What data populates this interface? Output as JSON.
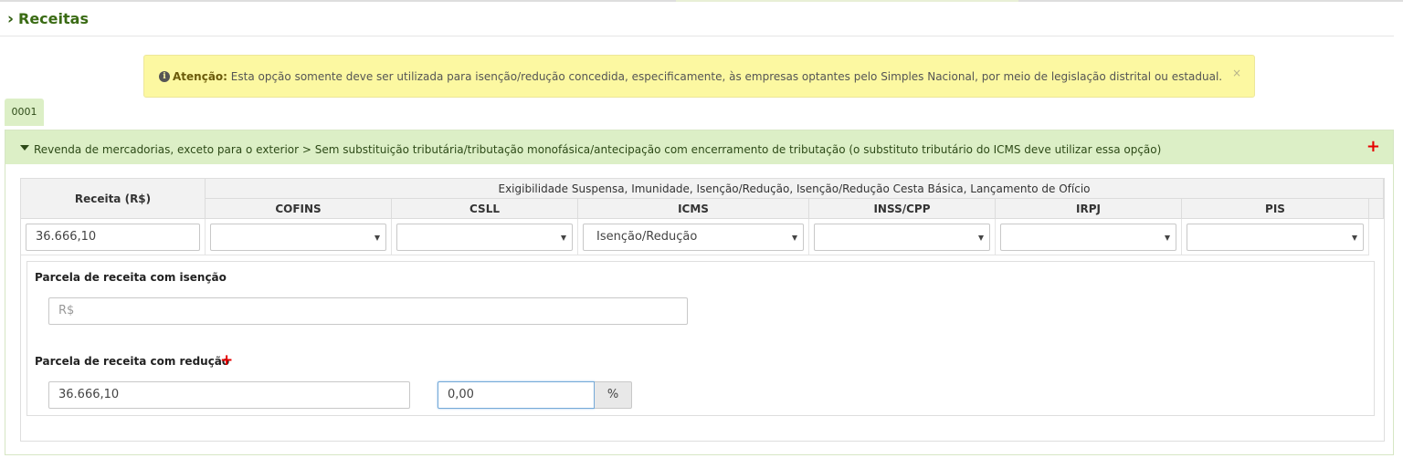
{
  "section": {
    "chevron": "›",
    "title": "Receitas"
  },
  "alert": {
    "icon": "info-circle-icon",
    "icon_glyph": "i",
    "label": "Atenção:",
    "message": "Esta opção somente deve ser utilizada para isenção/redução concedida, especificamente, às empresas optantes pelo Simples Nacional, por meio de legislação distrital ou estadual.",
    "close": "×"
  },
  "establishment": {
    "code": "0001"
  },
  "activity": {
    "title": "Revenda de mercadorias, exceto para o exterior > Sem substituição tributária/tributação monofásica/antecipação com encerramento de tributação (o substituto tributário do ICMS deve utilizar essa opção)",
    "add": "+"
  },
  "table": {
    "receita_header": "Receita (R$)",
    "group_header": "Exigibilidade Suspensa, Imunidade, Isenção/Redução, Isenção/Redução Cesta Básica, Lançamento de Ofício",
    "columns": [
      "COFINS",
      "CSLL",
      "ICMS",
      "INSS/CPP",
      "IRPJ",
      "PIS"
    ],
    "receita_value": "36.666,10",
    "selects": [
      "",
      "",
      "Isenção/Redução",
      "",
      "",
      ""
    ]
  },
  "isencao": {
    "label": "Parcela de receita com isenção",
    "placeholder": "R$"
  },
  "reducao": {
    "label": "Parcela de receita com redução",
    "add": "+",
    "value": "36.666,10",
    "percent_value": "0,00",
    "percent_addon": "%"
  },
  "colors": {
    "title_green": "#3a6b14",
    "panel_green": "#dcefc6",
    "alert_yellow": "#fcf8a1",
    "add_red": "#e60000"
  }
}
